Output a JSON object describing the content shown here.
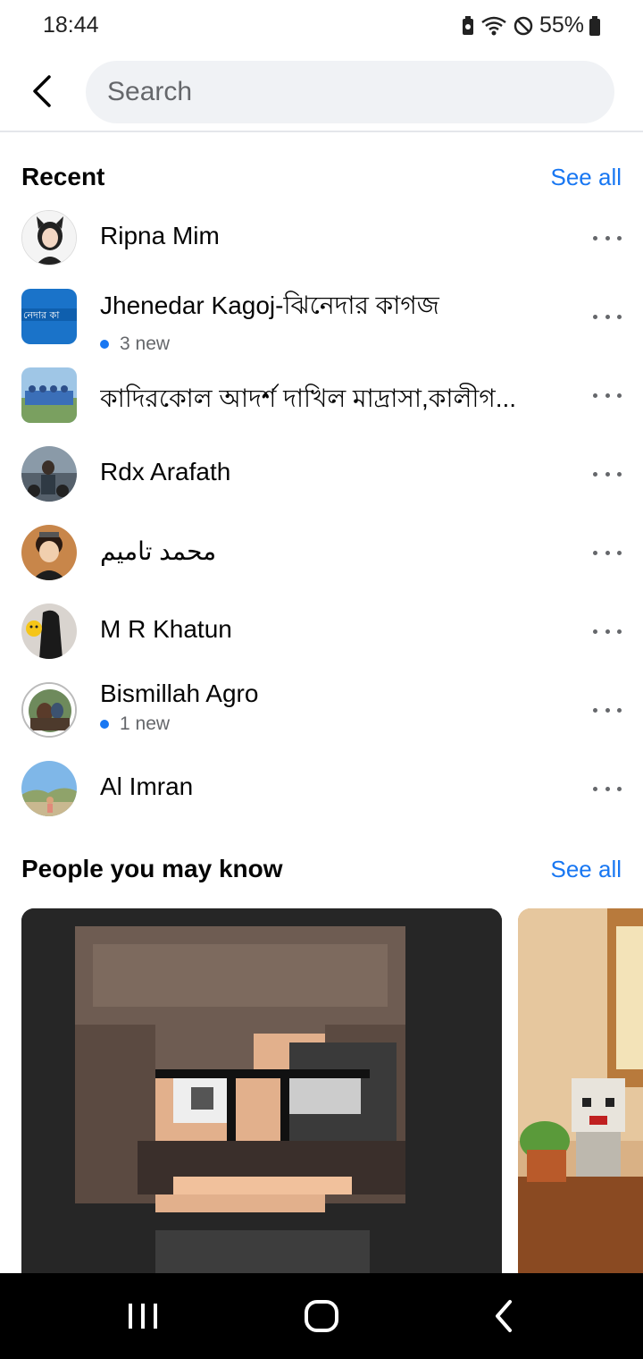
{
  "status_bar": {
    "time": "18:44",
    "battery": "55%"
  },
  "search": {
    "placeholder": "Search"
  },
  "recent": {
    "title": "Recent",
    "see_all": "See all",
    "items": [
      {
        "name": "Ripna Mim",
        "sub": ""
      },
      {
        "name": "Jhenedar Kagoj-ঝিনেদার কাগজ",
        "sub": "3 new"
      },
      {
        "name": "কাদিরকোল আদর্শ দাখিল মাদ্রাসা,কালীগ...",
        "sub": ""
      },
      {
        "name": "Rdx Arafath",
        "sub": ""
      },
      {
        "name": "محمد تاميم",
        "sub": ""
      },
      {
        "name": "M R Khatun",
        "sub": ""
      },
      {
        "name": "Bismillah Agro",
        "sub": "1 new"
      },
      {
        "name": "Al Imran",
        "sub": ""
      }
    ]
  },
  "people": {
    "title": "People you may know",
    "see_all": "See all"
  },
  "colors": {
    "accent": "#1877f2",
    "secondary_text": "#65676b",
    "search_bg": "#f0f2f5"
  },
  "icons": [
    "back-arrow-icon",
    "more-horizontal-icon",
    "recents-icon",
    "home-icon",
    "back-icon",
    "battery-icon",
    "wifi-icon",
    "do-not-disturb-icon"
  ]
}
